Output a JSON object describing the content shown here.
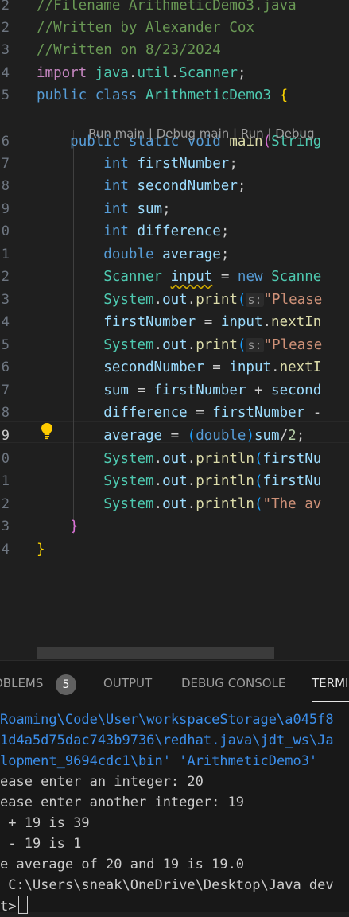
{
  "editor": {
    "codelens": {
      "run_main": "Run main",
      "debug_main": "Debug main",
      "run": "Run",
      "debug": "Debug",
      "sep": " | "
    },
    "lines": [
      {
        "num": "2",
        "tokens": [
          [
            "c",
            "//Filename ArithmeticDemo3.java"
          ]
        ]
      },
      {
        "num": "2",
        "tokens": [
          [
            "c",
            "//Written by Alexander Cox"
          ]
        ]
      },
      {
        "num": "3",
        "tokens": [
          [
            "c",
            "//Written on 8/23/2024"
          ]
        ]
      },
      {
        "num": "4",
        "tokens": [
          [
            "kc",
            "import"
          ],
          [
            "p",
            " "
          ],
          [
            "t",
            "java"
          ],
          [
            "p",
            "."
          ],
          [
            "t",
            "util"
          ],
          [
            "p",
            "."
          ],
          [
            "t",
            "Scanner"
          ],
          [
            "p",
            ";"
          ]
        ]
      },
      {
        "num": "5",
        "tokens": [
          [
            "k",
            "public"
          ],
          [
            "p",
            " "
          ],
          [
            "k",
            "class"
          ],
          [
            "p",
            " "
          ],
          [
            "t",
            "ArithmeticDemo3"
          ],
          [
            "p",
            " "
          ],
          [
            "br1",
            "{"
          ]
        ]
      },
      {
        "num": "6",
        "tokens": [
          [
            "p",
            "    "
          ],
          [
            "k",
            "public"
          ],
          [
            "p",
            " "
          ],
          [
            "k",
            "static"
          ],
          [
            "p",
            " "
          ],
          [
            "k",
            "void"
          ],
          [
            "p",
            " "
          ],
          [
            "f",
            "main"
          ],
          [
            "br2",
            "("
          ],
          [
            "t",
            "String"
          ]
        ]
      },
      {
        "num": "7",
        "tokens": [
          [
            "p",
            "        "
          ],
          [
            "k",
            "int"
          ],
          [
            "p",
            " "
          ],
          [
            "v",
            "firstNumber"
          ],
          [
            "p",
            ";"
          ]
        ]
      },
      {
        "num": "8",
        "tokens": [
          [
            "p",
            "        "
          ],
          [
            "k",
            "int"
          ],
          [
            "p",
            " "
          ],
          [
            "v",
            "secondNumber"
          ],
          [
            "p",
            ";"
          ]
        ]
      },
      {
        "num": "9",
        "tokens": [
          [
            "p",
            "        "
          ],
          [
            "k",
            "int"
          ],
          [
            "p",
            " "
          ],
          [
            "v",
            "sum"
          ],
          [
            "p",
            ";"
          ]
        ]
      },
      {
        "num": "0",
        "tokens": [
          [
            "p",
            "        "
          ],
          [
            "k",
            "int"
          ],
          [
            "p",
            " "
          ],
          [
            "v",
            "difference"
          ],
          [
            "p",
            ";"
          ]
        ]
      },
      {
        "num": "1",
        "tokens": [
          [
            "p",
            "        "
          ],
          [
            "k",
            "double"
          ],
          [
            "p",
            " "
          ],
          [
            "v",
            "average"
          ],
          [
            "p",
            ";"
          ]
        ]
      },
      {
        "num": "2",
        "tokens": [
          [
            "p",
            "        "
          ],
          [
            "t",
            "Scanner"
          ],
          [
            "p",
            " "
          ],
          [
            "sq",
            "input"
          ],
          [
            "p",
            " = "
          ],
          [
            "k",
            "new"
          ],
          [
            "p",
            " "
          ],
          [
            "t",
            "Scanne"
          ]
        ]
      },
      {
        "num": "3",
        "tokens": [
          [
            "p",
            "        "
          ],
          [
            "t",
            "System"
          ],
          [
            "p",
            "."
          ],
          [
            "v",
            "out"
          ],
          [
            "p",
            "."
          ],
          [
            "f",
            "print"
          ],
          [
            "br3",
            "("
          ],
          [
            "hint",
            "s:"
          ],
          [
            "s",
            "\"Please"
          ]
        ]
      },
      {
        "num": "4",
        "tokens": [
          [
            "p",
            "        "
          ],
          [
            "v",
            "firstNumber"
          ],
          [
            "p",
            " = "
          ],
          [
            "v",
            "input"
          ],
          [
            "p",
            "."
          ],
          [
            "f",
            "nextIn"
          ]
        ]
      },
      {
        "num": "5",
        "tokens": [
          [
            "p",
            "        "
          ],
          [
            "t",
            "System"
          ],
          [
            "p",
            "."
          ],
          [
            "v",
            "out"
          ],
          [
            "p",
            "."
          ],
          [
            "f",
            "print"
          ],
          [
            "br3",
            "("
          ],
          [
            "hint",
            "s:"
          ],
          [
            "s",
            "\"Please"
          ]
        ]
      },
      {
        "num": "6",
        "tokens": [
          [
            "p",
            "        "
          ],
          [
            "v",
            "secondNumber"
          ],
          [
            "p",
            " = "
          ],
          [
            "v",
            "input"
          ],
          [
            "p",
            "."
          ],
          [
            "f",
            "nextI"
          ]
        ]
      },
      {
        "num": "7",
        "tokens": [
          [
            "p",
            "        "
          ],
          [
            "v",
            "sum"
          ],
          [
            "p",
            " = "
          ],
          [
            "v",
            "firstNumber"
          ],
          [
            "p",
            " + "
          ],
          [
            "v",
            "second"
          ]
        ]
      },
      {
        "num": "8",
        "tokens": [
          [
            "p",
            "        "
          ],
          [
            "v",
            "difference"
          ],
          [
            "p",
            " = "
          ],
          [
            "v",
            "firstNumber"
          ],
          [
            "p",
            " -"
          ]
        ]
      },
      {
        "num": "9",
        "tokens": [
          [
            "p",
            "        "
          ],
          [
            "v",
            "average"
          ],
          [
            "p",
            " = "
          ],
          [
            "br3",
            "("
          ],
          [
            "k",
            "double"
          ],
          [
            "br3",
            ")"
          ],
          [
            "v",
            "sum"
          ],
          [
            "p",
            "/"
          ],
          [
            "n",
            "2"
          ],
          [
            "p",
            ";"
          ]
        ]
      },
      {
        "num": "0",
        "tokens": [
          [
            "p",
            "        "
          ],
          [
            "t",
            "System"
          ],
          [
            "p",
            "."
          ],
          [
            "v",
            "out"
          ],
          [
            "p",
            "."
          ],
          [
            "f",
            "println"
          ],
          [
            "br3",
            "("
          ],
          [
            "v",
            "firstNu"
          ]
        ]
      },
      {
        "num": "1",
        "tokens": [
          [
            "p",
            "        "
          ],
          [
            "t",
            "System"
          ],
          [
            "p",
            "."
          ],
          [
            "v",
            "out"
          ],
          [
            "p",
            "."
          ],
          [
            "f",
            "println"
          ],
          [
            "br3",
            "("
          ],
          [
            "v",
            "firstNu"
          ]
        ]
      },
      {
        "num": "2",
        "tokens": [
          [
            "p",
            "        "
          ],
          [
            "t",
            "System"
          ],
          [
            "p",
            "."
          ],
          [
            "v",
            "out"
          ],
          [
            "p",
            "."
          ],
          [
            "f",
            "println"
          ],
          [
            "br3",
            "("
          ],
          [
            "s",
            "\"The av"
          ]
        ]
      },
      {
        "num": "3",
        "tokens": [
          [
            "p",
            "    "
          ],
          [
            "br2",
            "}"
          ]
        ]
      },
      {
        "num": "4",
        "tokens": [
          [
            "br1",
            "}"
          ]
        ]
      }
    ]
  },
  "panel": {
    "tabs": {
      "problems": "OBLEMS",
      "problems_count": "5",
      "output": "OUTPUT",
      "debug_console": "DEBUG CONSOLE",
      "terminal": "TERMI"
    },
    "terminal_lines": [
      {
        "text": "Roaming\\Code\\User\\workspaceStorage\\a045f8",
        "path": true
      },
      {
        "text": "1d4a5d75dac743b9736\\redhat.java\\jdt_ws\\Ja",
        "path": true
      },
      {
        "text": "lopment_9694cdc1\\bin' 'ArithmeticDemo3'",
        "path": true
      },
      {
        "text": "ease enter an integer: 20",
        "path": false
      },
      {
        "text": "ease enter another integer: 19",
        "path": false
      },
      {
        "text": " + 19 is 39",
        "path": false
      },
      {
        "text": " - 19 is 1",
        "path": false
      },
      {
        "text": "e average of 20 and 19 is 19.0",
        "path": false
      },
      {
        "text": " C:\\Users\\sneak\\OneDrive\\Desktop\\Java dev",
        "path": false
      },
      {
        "text": "t>",
        "path": false
      }
    ]
  }
}
